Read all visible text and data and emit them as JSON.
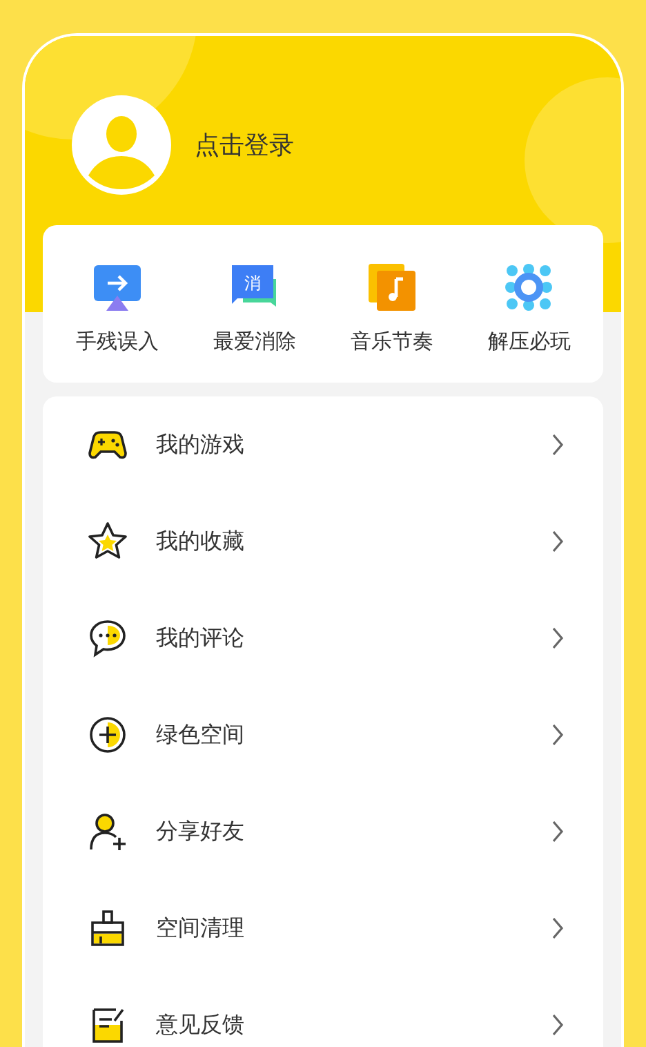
{
  "profile": {
    "login_label": "点击登录"
  },
  "quick_actions": [
    {
      "label": "手残误入"
    },
    {
      "label": "最爱消除",
      "icon_text": "消"
    },
    {
      "label": "音乐节奏"
    },
    {
      "label": "解压必玩"
    }
  ],
  "menu": [
    {
      "label": "我的游戏"
    },
    {
      "label": "我的收藏"
    },
    {
      "label": "我的评论"
    },
    {
      "label": "绿色空间"
    },
    {
      "label": "分享好友"
    },
    {
      "label": "空间清理"
    },
    {
      "label": "意见反馈"
    }
  ]
}
